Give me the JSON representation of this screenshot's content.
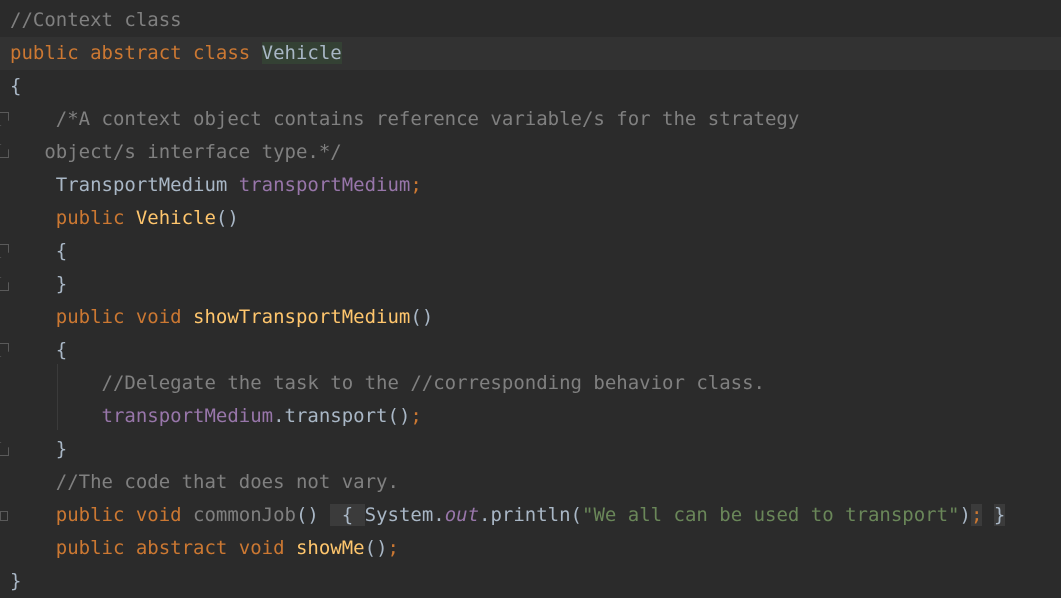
{
  "editor": {
    "lines": [
      {
        "tokens": [
          {
            "t": "//Context class",
            "c": "cm"
          }
        ]
      },
      {
        "tokens": [
          {
            "t": "public abstract class ",
            "c": "kw"
          },
          {
            "t": "Vehicle",
            "c": "hl-class"
          }
        ]
      },
      {
        "tokens": [
          {
            "t": "{",
            "c": ""
          }
        ]
      },
      {
        "tokens": [
          {
            "t": "    /*A context object contains reference variable/s for the strategy",
            "c": "cm"
          }
        ]
      },
      {
        "tokens": [
          {
            "t": "   object/s interface type.*/",
            "c": "cm"
          }
        ]
      },
      {
        "tokens": [
          {
            "t": "    TransportMedium ",
            "c": ""
          },
          {
            "t": "transportMedium",
            "c": "fld"
          },
          {
            "t": ";",
            "c": "sem"
          }
        ]
      },
      {
        "tokens": [
          {
            "t": "    public ",
            "c": "kw"
          },
          {
            "t": "Vehicle",
            "c": "fn"
          },
          {
            "t": "()",
            "c": ""
          }
        ]
      },
      {
        "tokens": [
          {
            "t": "    {",
            "c": ""
          }
        ]
      },
      {
        "tokens": [
          {
            "t": "    }",
            "c": ""
          }
        ]
      },
      {
        "tokens": [
          {
            "t": "    public void ",
            "c": "kw"
          },
          {
            "t": "showTransportMedium",
            "c": "fn"
          },
          {
            "t": "()",
            "c": ""
          }
        ]
      },
      {
        "tokens": [
          {
            "t": "    {",
            "c": ""
          }
        ]
      },
      {
        "tokens": [
          {
            "t": "        //Delegate the task to the //corresponding behavior class.",
            "c": "cm"
          }
        ]
      },
      {
        "tokens": [
          {
            "t": "        ",
            "c": ""
          },
          {
            "t": "transportMedium",
            "c": "fld"
          },
          {
            "t": ".transport()",
            "c": ""
          },
          {
            "t": ";",
            "c": "sem"
          }
        ]
      },
      {
        "tokens": [
          {
            "t": "    }",
            "c": ""
          }
        ]
      },
      {
        "tokens": [
          {
            "t": "    //The code that does not vary.",
            "c": "cm"
          }
        ]
      },
      {
        "tokens": [
          {
            "t": "    public void ",
            "c": "kw"
          },
          {
            "t": "commonJob",
            "c": "cm"
          },
          {
            "t": "() ",
            "c": ""
          },
          {
            "t": " { ",
            "c": "brace-hl"
          },
          {
            "t": "System.",
            "c": ""
          },
          {
            "t": "out",
            "c": "ital"
          },
          {
            "t": ".println(",
            "c": ""
          },
          {
            "t": "\"We all can be used to transport\"",
            "c": "str"
          },
          {
            "t": ")",
            "c": ""
          },
          {
            "t": ";",
            "c": "sem brace-hl"
          },
          {
            "t": " ",
            "c": ""
          },
          {
            "t": "}",
            "c": "brace-hl"
          }
        ]
      },
      {
        "tokens": [
          {
            "t": "    public abstract void ",
            "c": "kw"
          },
          {
            "t": "showMe",
            "c": "fn"
          },
          {
            "t": "()",
            "c": ""
          },
          {
            "t": ";",
            "c": "sem"
          }
        ]
      },
      {
        "tokens": [
          {
            "t": "}",
            "c": ""
          }
        ]
      }
    ],
    "current_line": 1,
    "colors": {
      "background": "#2b2b2b",
      "keyword": "#cc7832",
      "comment": "#808080",
      "method": "#ffc66d",
      "field": "#9876aa",
      "string": "#6a8759",
      "text": "#a9b7c6"
    }
  }
}
